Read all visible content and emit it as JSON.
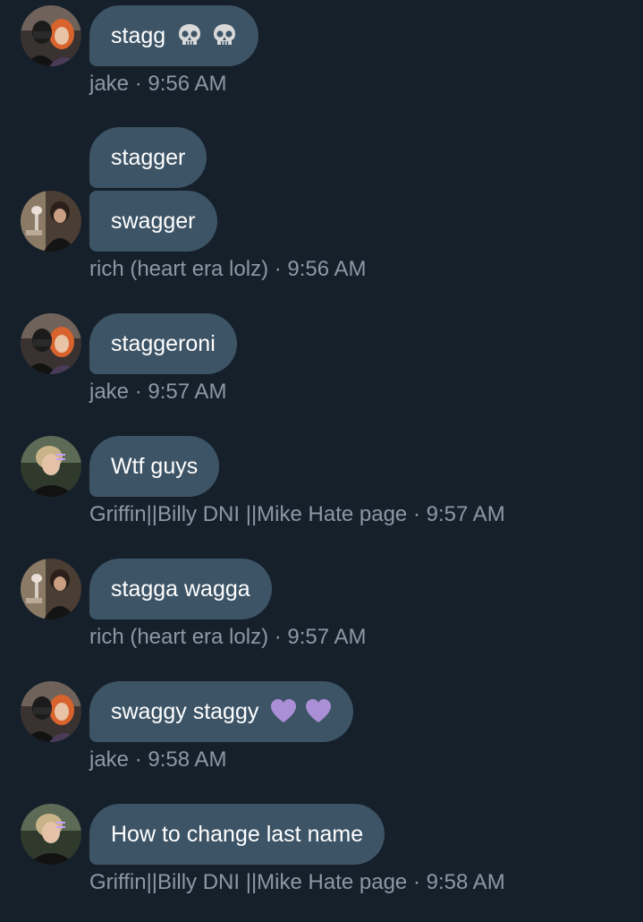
{
  "colors": {
    "background": "#15202b",
    "bubble": "#3d5466",
    "bubble_text": "#ffffff",
    "meta_text": "#8b98a5"
  },
  "messages": [
    {
      "sender": "jake",
      "time": "9:56 AM",
      "bubbles": [
        {
          "text": "stagg",
          "emoji": [
            "skull-emoji",
            "skull-emoji"
          ]
        }
      ]
    },
    {
      "sender": "rich (heart era lolz)",
      "time": "9:56 AM",
      "bubbles": [
        {
          "text": "stagger"
        },
        {
          "text": "swagger"
        }
      ]
    },
    {
      "sender": "jake",
      "time": "9:57 AM",
      "bubbles": [
        {
          "text": "staggeroni"
        }
      ]
    },
    {
      "sender": "Griffin||Billy DNI ||Mike Hate page",
      "time": "9:57 AM",
      "bubbles": [
        {
          "text": "Wtf guys"
        }
      ]
    },
    {
      "sender": "rich (heart era lolz)",
      "time": "9:57 AM",
      "bubbles": [
        {
          "text": "stagga wagga"
        }
      ]
    },
    {
      "sender": "jake",
      "time": "9:58 AM",
      "bubbles": [
        {
          "text": "swaggy staggy",
          "emoji": [
            "purple-heart-emoji",
            "purple-heart-emoji"
          ]
        }
      ]
    },
    {
      "sender": "Griffin||Billy DNI ||Mike Hate page",
      "time": "9:58 AM",
      "bubbles": [
        {
          "text": "How to change last name"
        }
      ]
    }
  ]
}
